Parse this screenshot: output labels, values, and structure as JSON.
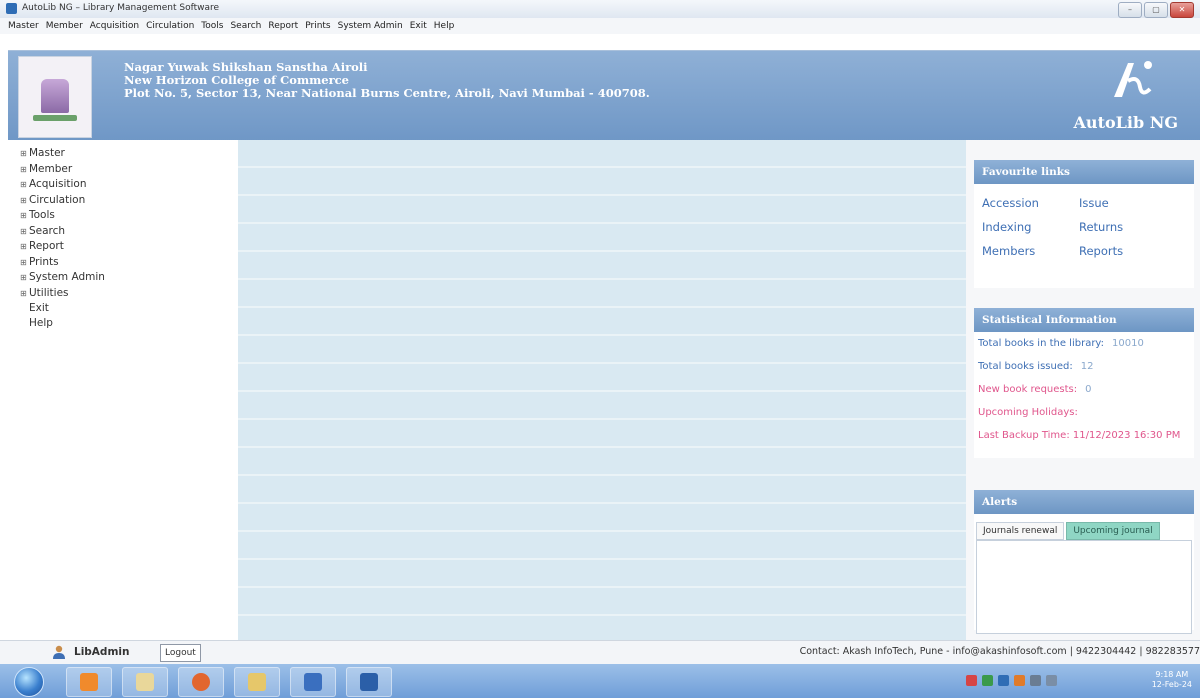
{
  "window": {
    "title": "AutoLib NG – Library Management Software",
    "buttons": [
      "–",
      "▢",
      "✕"
    ]
  },
  "menubar": [
    "Master",
    "Member",
    "Acquisition",
    "Circulation",
    "Tools",
    "Search",
    "Report",
    "Prints",
    "System Admin",
    "Exit",
    "Help"
  ],
  "header": {
    "org_line1": "Nagar Yuwak Shikshan Sanstha Airoli",
    "org_line2": "New Horizon College of Commerce",
    "org_line3": "Plot No. 5, Sector 13, Near National Burns Centre, Airoli, Navi Mumbai - 400708.",
    "brand_name": "AutoLib NG"
  },
  "leftnav": {
    "items": [
      {
        "label": "Master",
        "expand": "⊞"
      },
      {
        "label": "Member",
        "expand": "⊞"
      },
      {
        "label": "Acquisition",
        "expand": "⊞"
      },
      {
        "label": "Circulation",
        "expand": "⊞"
      },
      {
        "label": "Tools",
        "expand": "⊞"
      },
      {
        "label": "Search",
        "expand": "⊞"
      },
      {
        "label": "Report",
        "expand": "⊞"
      },
      {
        "label": "Prints",
        "expand": "⊞"
      },
      {
        "label": "System Admin",
        "expand": "⊞"
      },
      {
        "label": "Utilities",
        "expand": "⊞"
      },
      {
        "label": "Exit",
        "expand": ""
      },
      {
        "label": "Help",
        "expand": ""
      }
    ]
  },
  "favourites": {
    "title": "Favourite links",
    "links": [
      "Accession",
      "Issue",
      "Indexing",
      "Returns",
      "Members",
      "Reports"
    ]
  },
  "stats": {
    "title": "Statistical Information",
    "rows": [
      {
        "label": "Total books in the library:",
        "value": "10010"
      },
      {
        "label": "Total books issued:",
        "value": "12"
      },
      {
        "label": "New book requests:",
        "value": "0"
      },
      {
        "label": "Upcoming Holidays:",
        "value": ""
      },
      {
        "label": "Last Backup Time:",
        "value": "11/12/2023 16:30 PM"
      }
    ]
  },
  "alerts": {
    "title": "Alerts",
    "tabs": [
      "Journals renewal",
      "Upcoming journal"
    ]
  },
  "statusbar": {
    "username": "LibAdmin",
    "logout": "Logout",
    "contact": "Contact: Akash InfoTech, Pune - info@akashinfosoft.com | 9422304442 | 982283577"
  },
  "taskbar": {
    "clock_time": "9:18 AM",
    "clock_date": "12-Feb-24"
  }
}
